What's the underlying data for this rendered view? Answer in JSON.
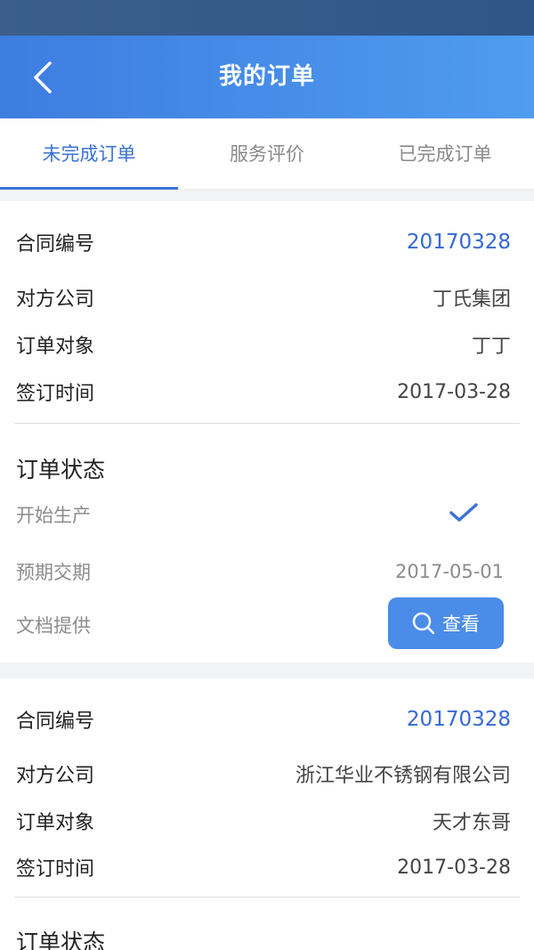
{
  "header": {
    "title": "我的订单"
  },
  "tabs": [
    {
      "label": "未完成订单"
    },
    {
      "label": "服务评价"
    },
    {
      "label": "已完成订单"
    }
  ],
  "orders": [
    {
      "contract_label": "合同编号",
      "contract_value": "20170328",
      "company_label": "对方公司",
      "company_value": "丁氏集团",
      "object_label": "订单对象",
      "object_value": "丁丁",
      "sign_label": "签订时间",
      "sign_value": "2017-03-28",
      "status_title": "订单状态",
      "production_label": "开始生产",
      "delivery_label": "预期交期",
      "delivery_value": "2017-05-01",
      "docs_label": "文档提供",
      "view_button": "查看"
    },
    {
      "contract_label": "合同编号",
      "contract_value": "20170328",
      "company_label": "对方公司",
      "company_value": "浙江华业不锈钢有限公司",
      "object_label": "订单对象",
      "object_value": "天才东哥",
      "sign_label": "签订时间",
      "sign_value": "2017-03-28",
      "status_title": "订单状态"
    }
  ],
  "colors": {
    "accent": "#3a73d4",
    "header_start": "#3d7de0",
    "header_end": "#4f9cf0",
    "button": "#4a8ce8"
  },
  "icons": {
    "back": "chevron-left-icon",
    "check": "check-icon",
    "search": "search-icon"
  }
}
